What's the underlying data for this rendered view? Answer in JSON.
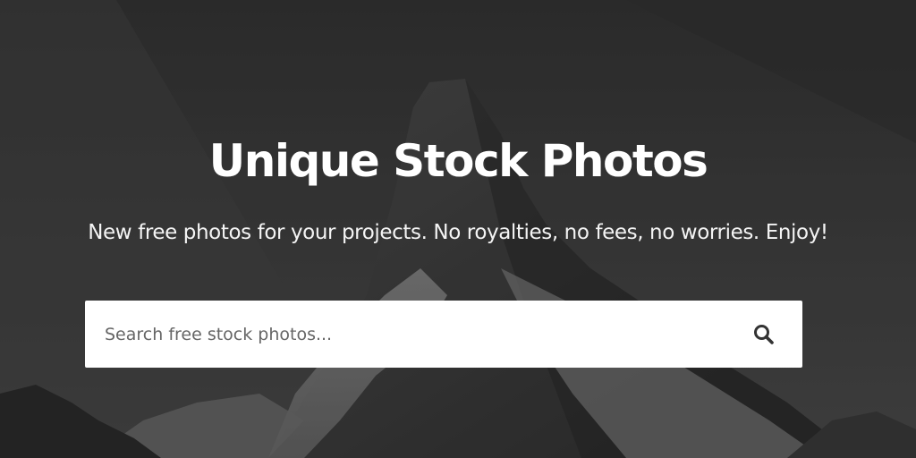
{
  "hero": {
    "title": "Unique Stock Photos",
    "subtitle": "New free photos for your projects. No royalties, no fees, no worries. Enjoy!",
    "background": "mountain-photo"
  },
  "search": {
    "placeholder": "Search free stock photos...",
    "value": "",
    "button_icon": "search-icon"
  },
  "colors": {
    "title_text": "#ffffff",
    "search_box": "#ffffff",
    "icon": "#333333"
  }
}
